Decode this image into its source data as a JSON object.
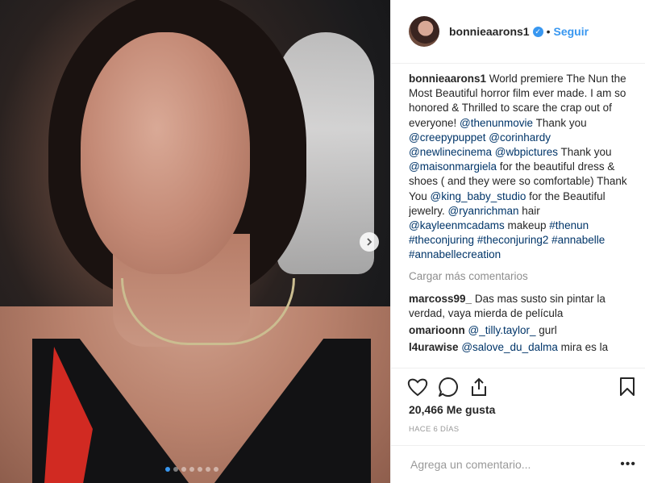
{
  "post": {
    "carousel": {
      "total_slides": 7,
      "current_slide": 1
    }
  },
  "header": {
    "username": "bonnieaarons1",
    "separator": "•",
    "follow_label": "Seguir"
  },
  "caption": {
    "username": "bonnieaarons1",
    "parts": [
      " World premiere The Nun the Most Beautiful horror film ever made. I am so honored & Thrilled to scare the crap out of everyone! ",
      "@thenunmovie",
      " Thank you ",
      "@creepypuppet",
      " ",
      "@corinhardy",
      " ",
      "@newlinecinema",
      " ",
      "@wbpictures",
      " Thank you ",
      "@maisonmargiela",
      " for the beautiful dress & shoes ( and they were so comfortable) Thank You ",
      "@king_baby_studio",
      " for the Beautiful jewelry. ",
      "@ryanrichman",
      " hair ",
      "@kayleenmcadams",
      " makeup ",
      "#thenun",
      " ",
      "#theconjuring",
      " ",
      "#theconjuring2",
      " ",
      "#annabelle",
      " ",
      "#annabellecreation"
    ]
  },
  "load_more_label": "Cargar más comentarios",
  "comments": [
    {
      "user": "marcoss99_",
      "text": " Das mas susto sin pintar la verdad, vaya mierda de película",
      "mention": ""
    },
    {
      "user": "omarioonn",
      "text": " gurl",
      "mention": "@_tilly.taylor_"
    },
    {
      "user": "l4urawise",
      "text": " mira es la",
      "mention": "@salove_du_dalma"
    }
  ],
  "likes_label": "20,466 Me gusta",
  "time_label": "HACE 6 DÍAS",
  "add_comment": {
    "placeholder": "Agrega un comentario...",
    "more": "•••"
  },
  "icons": {
    "like": "heart-icon",
    "comment": "comment-bubble-icon",
    "share": "share-icon",
    "save": "bookmark-icon",
    "next": "chevron-right-icon",
    "verified": "verified-badge-icon"
  },
  "colors": {
    "link": "#003569",
    "accent": "#3897f0",
    "muted": "#8e8e8e"
  }
}
